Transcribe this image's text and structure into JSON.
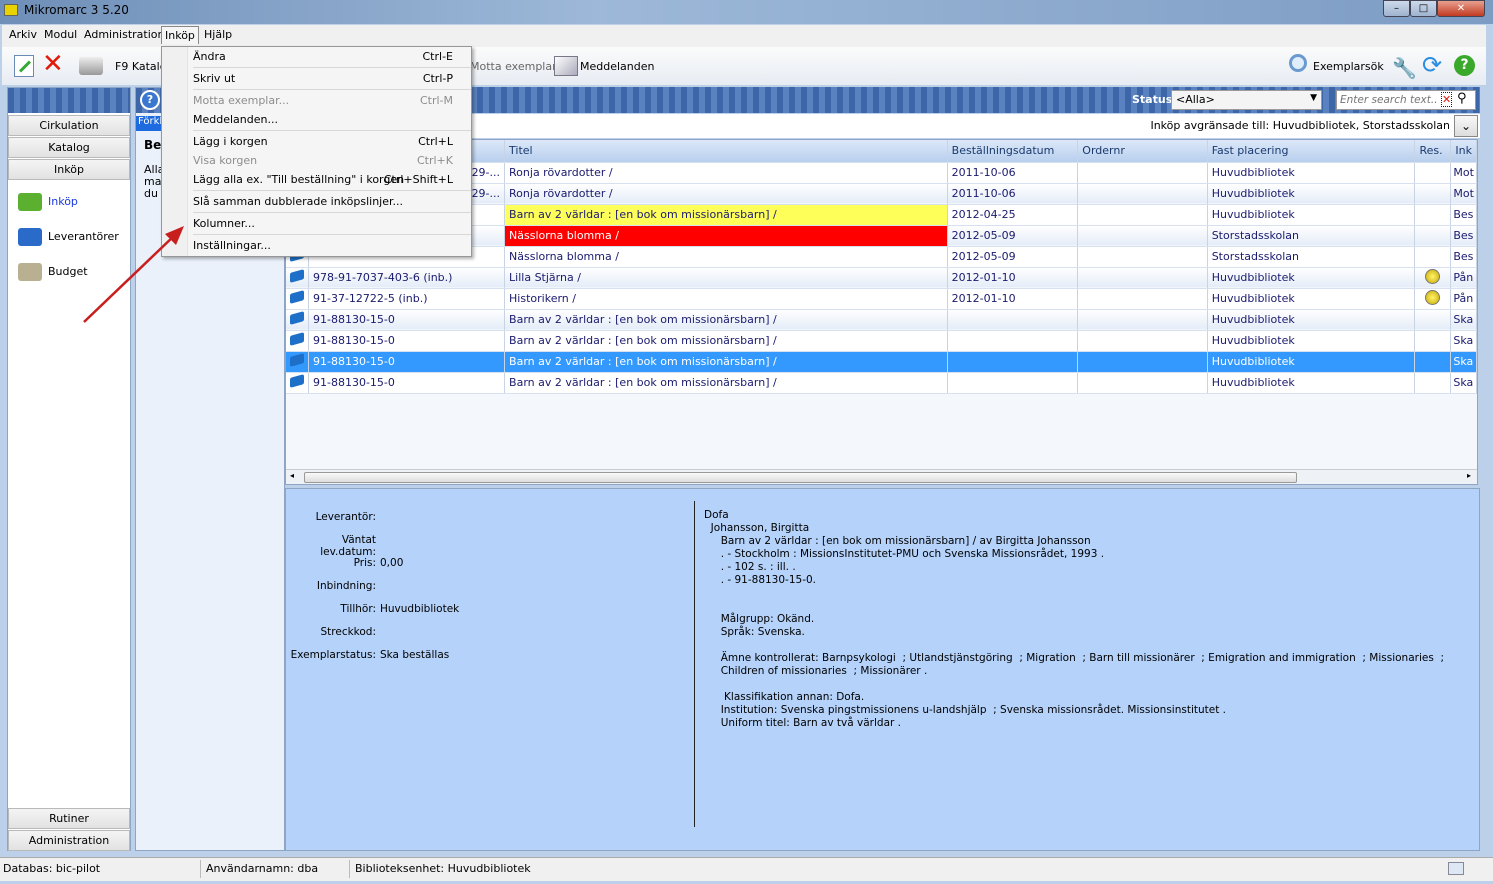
{
  "window": {
    "title": "Mikromarc 3 5.20",
    "controls": [
      "–",
      "□",
      "✕"
    ]
  },
  "menubar": [
    "Arkiv",
    "Modul",
    "Administration",
    "Inköp",
    "Hjälp"
  ],
  "toolbar": {
    "catalog": "F9 Katalo",
    "receive": "Motta exemplar",
    "messages": "Meddelanden",
    "item_search": "Exemplarsök"
  },
  "menu": {
    "items": [
      {
        "label": "Ändra",
        "shortcut": "Ctrl-E",
        "disabled": false
      },
      {
        "label": "Skriv ut",
        "shortcut": "Ctrl-P",
        "disabled": false
      },
      {
        "label": "Motta exemplar...",
        "shortcut": "Ctrl-M",
        "disabled": true
      },
      {
        "label": "Meddelanden...",
        "shortcut": "",
        "disabled": false
      },
      {
        "label": "Lägg i korgen",
        "shortcut": "Ctrl+L",
        "disabled": false
      },
      {
        "label": "Visa korgen",
        "shortcut": "Ctrl+K",
        "disabled": true
      },
      {
        "label": "Lägg alla ex. \"Till beställning\" i korgen",
        "shortcut": "Ctrl+Shift+L",
        "disabled": false
      },
      {
        "label": "Slå samman dubblerade inköpslinjer...",
        "shortcut": "",
        "disabled": false
      },
      {
        "label": "Kolumner...",
        "shortcut": "",
        "disabled": false
      },
      {
        "label": "Inställningar...",
        "shortcut": "",
        "disabled": false
      }
    ]
  },
  "sidebar": {
    "modules": [
      "Cirkulation",
      "Katalog",
      "Inköp"
    ],
    "nav": [
      {
        "label": "Inköp",
        "icon": "money-icon"
      },
      {
        "label": "Leverantörer",
        "icon": "truck-icon"
      },
      {
        "label": "Budget",
        "icon": "cash-icon"
      }
    ],
    "bottom": [
      "Rutiner",
      "Administration"
    ]
  },
  "mid": {
    "tab": "Förkla",
    "heading": "Bes",
    "text": "Alla\nmat\ndu"
  },
  "filter": {
    "status_label": "Status:",
    "status_value": "<Alla>",
    "search_placeholder": "Enter search text...",
    "restriction": "Inköp avgränsade till: Huvudbibliotek, Storstadsskolan"
  },
  "table": {
    "columns": [
      "",
      "",
      "Titel",
      "Beställningsdatum",
      "Ordernr",
      "Fast placering",
      "Res.",
      "Ink"
    ],
    "rows": [
      {
        "isbn": "29-...",
        "title": "Ronja rövardotter /",
        "date": "2011-10-06",
        "order": "",
        "place": "Huvudbibliotek",
        "res": false,
        "ink": "Mot",
        "hl": ""
      },
      {
        "isbn": "29-...",
        "title": "Ronja rövardotter /",
        "date": "2011-10-06",
        "order": "",
        "place": "Huvudbibliotek",
        "res": false,
        "ink": "Mot",
        "hl": ""
      },
      {
        "isbn": "",
        "title": "Barn av 2 världar : [en bok om missionärsbarn] /",
        "date": "2012-04-25",
        "order": "",
        "place": "Huvudbibliotek",
        "res": false,
        "ink": "Bes",
        "hl": "yellow"
      },
      {
        "isbn": "",
        "title": "Nässlorna blomma /",
        "date": "2012-05-09",
        "order": "",
        "place": "Storstadsskolan",
        "res": false,
        "ink": "Bes",
        "hl": "red"
      },
      {
        "isbn": "",
        "title": "Nässlorna blomma /",
        "date": "2012-05-09",
        "order": "",
        "place": "Storstadsskolan",
        "res": false,
        "ink": "Bes",
        "hl": ""
      },
      {
        "isbn": "978-91-7037-403-6 (inb.)",
        "title": "Lilla Stjärna /",
        "date": "2012-01-10",
        "order": "",
        "place": "Huvudbibliotek",
        "res": true,
        "ink": "Pån",
        "hl": ""
      },
      {
        "isbn": "91-37-12722-5 (inb.)",
        "title": "Historikern /",
        "date": "2012-01-10",
        "order": "",
        "place": "Huvudbibliotek",
        "res": true,
        "ink": "Pån",
        "hl": ""
      },
      {
        "isbn": "91-88130-15-0",
        "title": "Barn av 2 världar : [en bok om missionärsbarn] /",
        "date": "",
        "order": "",
        "place": "Huvudbibliotek",
        "res": false,
        "ink": "Ska",
        "hl": ""
      },
      {
        "isbn": "91-88130-15-0",
        "title": "Barn av 2 världar : [en bok om missionärsbarn] /",
        "date": "",
        "order": "",
        "place": "Huvudbibliotek",
        "res": false,
        "ink": "Ska",
        "hl": ""
      },
      {
        "isbn": "91-88130-15-0",
        "title": "Barn av 2 världar : [en bok om missionärsbarn] /",
        "date": "",
        "order": "",
        "place": "Huvudbibliotek",
        "res": false,
        "ink": "Ska",
        "hl": "sel"
      },
      {
        "isbn": "91-88130-15-0",
        "title": "Barn av 2 världar : [en bok om missionärsbarn] /",
        "date": "",
        "order": "",
        "place": "Huvudbibliotek",
        "res": false,
        "ink": "Ska",
        "hl": ""
      }
    ]
  },
  "details": [
    {
      "label": "Leverantör:",
      "value": ""
    },
    {
      "label": "Väntat lev.datum:",
      "value": ""
    },
    {
      "label": "Pris:",
      "value": "0,00"
    },
    {
      "label": "Inbindning:",
      "value": ""
    },
    {
      "label": "Tillhör:",
      "value": "Huvudbibliotek"
    },
    {
      "label": "Streckkod:",
      "value": ""
    },
    {
      "label": "Exemplarstatus:",
      "value": "Ska beställas"
    }
  ],
  "card": "Dofa\n  Johansson, Birgitta\n     Barn av 2 världar : [en bok om missionärsbarn] / av Birgitta Johansson\n     . - Stockholm : MissionsInstitutet-PMU och Svenska Missionsrådet, 1993 .\n     . - 102 s. : ill. .\n     . - 91-88130-15-0.\n\n\n     Målgrupp: Okänd.\n     Språk: Svenska.\n\n     Ämne kontrollerat: Barnpsykologi  ; Utlandstjänstgöring  ; Migration  ; Barn till missionärer  ; Emigration and immigration  ; Missionaries  ;\n     Children of missionaries  ; Missionärer .\n\n      Klassifikation annan: Dofa.\n     Institution: Svenska pingstmissionens u-landshjälp  ; Svenska missionsrådet. Missionsinstitutet .\n     Uniform titel: Barn av två världar .",
  "statusbar": [
    "Databas: bic-pilot",
    "Användarnamn: dba",
    "Biblioteksenhet: Huvudbibliotek"
  ],
  "colors": {
    "selection": "#3399ff",
    "highlight_yellow": "#ffff5a",
    "highlight_red": "#ff0000",
    "detail_bg": "#b4d2fa"
  }
}
